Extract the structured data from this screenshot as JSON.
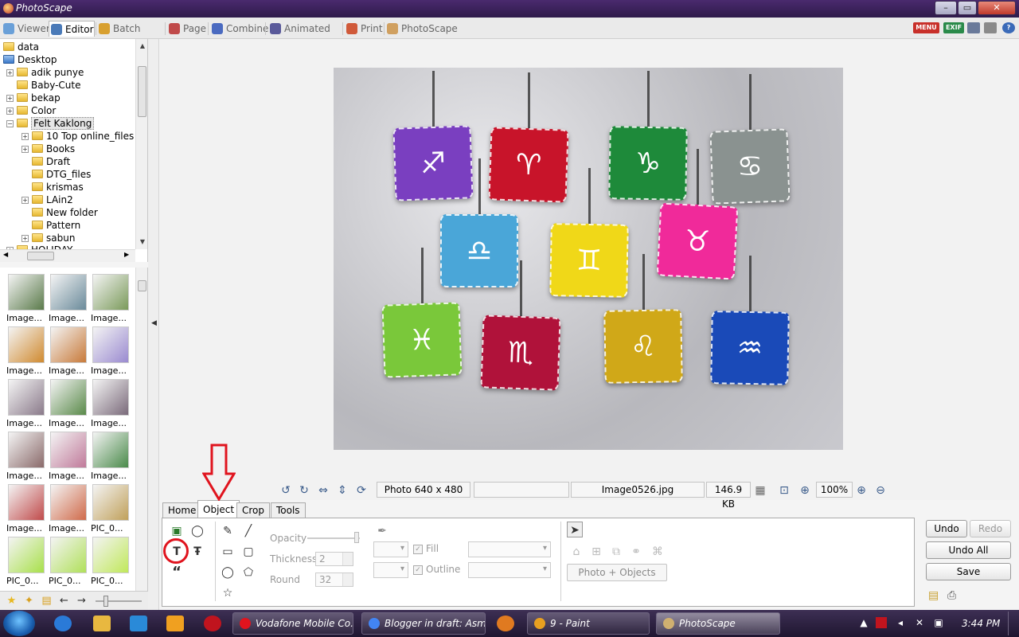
{
  "window": {
    "title": "PhotoScape",
    "controls": [
      "–",
      "▭",
      "✕"
    ]
  },
  "top_tabs": [
    {
      "label": "Viewer",
      "active": false
    },
    {
      "label": "Editor",
      "active": true
    },
    {
      "label": "Batch Editor",
      "active": false
    },
    {
      "label": "Page",
      "active": false
    },
    {
      "label": "Combine",
      "active": false
    },
    {
      "label": "Animated GIF",
      "active": false
    },
    {
      "label": "Print",
      "active": false
    },
    {
      "label": "PhotoScape",
      "active": false
    }
  ],
  "top_right": {
    "menu_label": "MENU",
    "exif_label": "EXIF"
  },
  "tree": {
    "items": [
      {
        "label": "data",
        "level": 0,
        "expander": ""
      },
      {
        "label": "Desktop",
        "level": 0,
        "expander": "",
        "icon": "blue"
      },
      {
        "label": "adik punye",
        "level": 1,
        "expander": "+"
      },
      {
        "label": "Baby-Cute",
        "level": 1,
        "expander": ""
      },
      {
        "label": "bekap",
        "level": 1,
        "expander": "+"
      },
      {
        "label": "Color",
        "level": 1,
        "expander": "+"
      },
      {
        "label": "Felt Kaklong",
        "level": 1,
        "expander": "−",
        "selected": true
      },
      {
        "label": "10 Top online_files",
        "level": 2,
        "expander": "+"
      },
      {
        "label": "Books",
        "level": 2,
        "expander": "+"
      },
      {
        "label": "Draft",
        "level": 2,
        "expander": ""
      },
      {
        "label": "DTG_files",
        "level": 2,
        "expander": ""
      },
      {
        "label": "krismas",
        "level": 2,
        "expander": ""
      },
      {
        "label": "LAin2",
        "level": 2,
        "expander": "+"
      },
      {
        "label": "New folder",
        "level": 2,
        "expander": ""
      },
      {
        "label": "Pattern",
        "level": 2,
        "expander": ""
      },
      {
        "label": "sabun",
        "level": 2,
        "expander": "+"
      },
      {
        "label": "HOLIDAY",
        "level": 1,
        "expander": "+"
      }
    ]
  },
  "thumbnails": [
    {
      "caption": "Image...",
      "color": "#5a7a4a"
    },
    {
      "caption": "Image...",
      "color": "#6a8a9a"
    },
    {
      "caption": "Image...",
      "color": "#7a9a5a"
    },
    {
      "caption": "Image...",
      "color": "#d08a30"
    },
    {
      "caption": "Image...",
      "color": "#c87a3a"
    },
    {
      "caption": "Image...",
      "color": "#9a8ad0"
    },
    {
      "caption": "Image...",
      "color": "#8a7a8a"
    },
    {
      "caption": "Image...",
      "color": "#5a8a4a"
    },
    {
      "caption": "Image...",
      "color": "#7a6a7a"
    },
    {
      "caption": "Image...",
      "color": "#8a6a6a"
    },
    {
      "caption": "Image...",
      "color": "#c07a9a"
    },
    {
      "caption": "Image...",
      "color": "#4a8a4a"
    },
    {
      "caption": "Image...",
      "color": "#c04a4a"
    },
    {
      "caption": "Image...",
      "color": "#d06a4a"
    },
    {
      "caption": "PIC_0...",
      "color": "#c0a05a"
    },
    {
      "caption": "PIC_0...",
      "color": "#a8e04a"
    },
    {
      "caption": "PIC_0...",
      "color": "#b0e05a"
    },
    {
      "caption": "PIC_0...",
      "color": "#c0e85a"
    }
  ],
  "status": {
    "photo_size": "Photo 640 x 480",
    "filename": "Image0526.jpg",
    "filesize": "146.9 KB",
    "zoom": "100%"
  },
  "bottom_tabs": [
    {
      "label": "Home",
      "active": false
    },
    {
      "label": "Object",
      "active": true
    },
    {
      "label": "Crop",
      "active": false
    },
    {
      "label": "Tools",
      "active": false
    }
  ],
  "object_panel": {
    "opacity_label": "Opacity",
    "thickness_label": "Thickness",
    "thickness_value": "2",
    "round_label": "Round",
    "round_value": "32",
    "fill_label": "Fill",
    "outline_label": "Outline",
    "photo_objects_label": "Photo + Objects"
  },
  "right_buttons": {
    "undo": "Undo",
    "redo": "Redo",
    "undo_all": "Undo All",
    "save": "Save"
  },
  "photo": {
    "felts": [
      {
        "sym": "♐",
        "color": "#7a3fc0"
      },
      {
        "sym": "♈",
        "color": "#c8142a"
      },
      {
        "sym": "♑",
        "color": "#1e8a3a"
      },
      {
        "sym": "♋",
        "color": "#8a9290"
      },
      {
        "sym": "♎",
        "color": "#4aa6d8"
      },
      {
        "sym": "♊",
        "color": "#f0d818"
      },
      {
        "sym": "♉",
        "color": "#f02a9a"
      },
      {
        "sym": "♓",
        "color": "#7ac83a"
      },
      {
        "sym": "♏",
        "color": "#b0123a"
      },
      {
        "sym": "♌",
        "color": "#d0a818"
      },
      {
        "sym": "♒",
        "color": "#1a4ab8"
      }
    ]
  },
  "taskbar": {
    "tasks": [
      {
        "label": "Vodafone Mobile Co...",
        "icon_color": "#e0141e",
        "active": false
      },
      {
        "label": "Blogger in draft: Asm...",
        "icon_color": "#4285f4",
        "active": false
      },
      {
        "label": "9 - Paint",
        "icon_color": "#e8a020",
        "active": false
      },
      {
        "label": "PhotoScape",
        "icon_color": "#d0b070",
        "active": true
      }
    ],
    "time": "3:44 PM"
  }
}
